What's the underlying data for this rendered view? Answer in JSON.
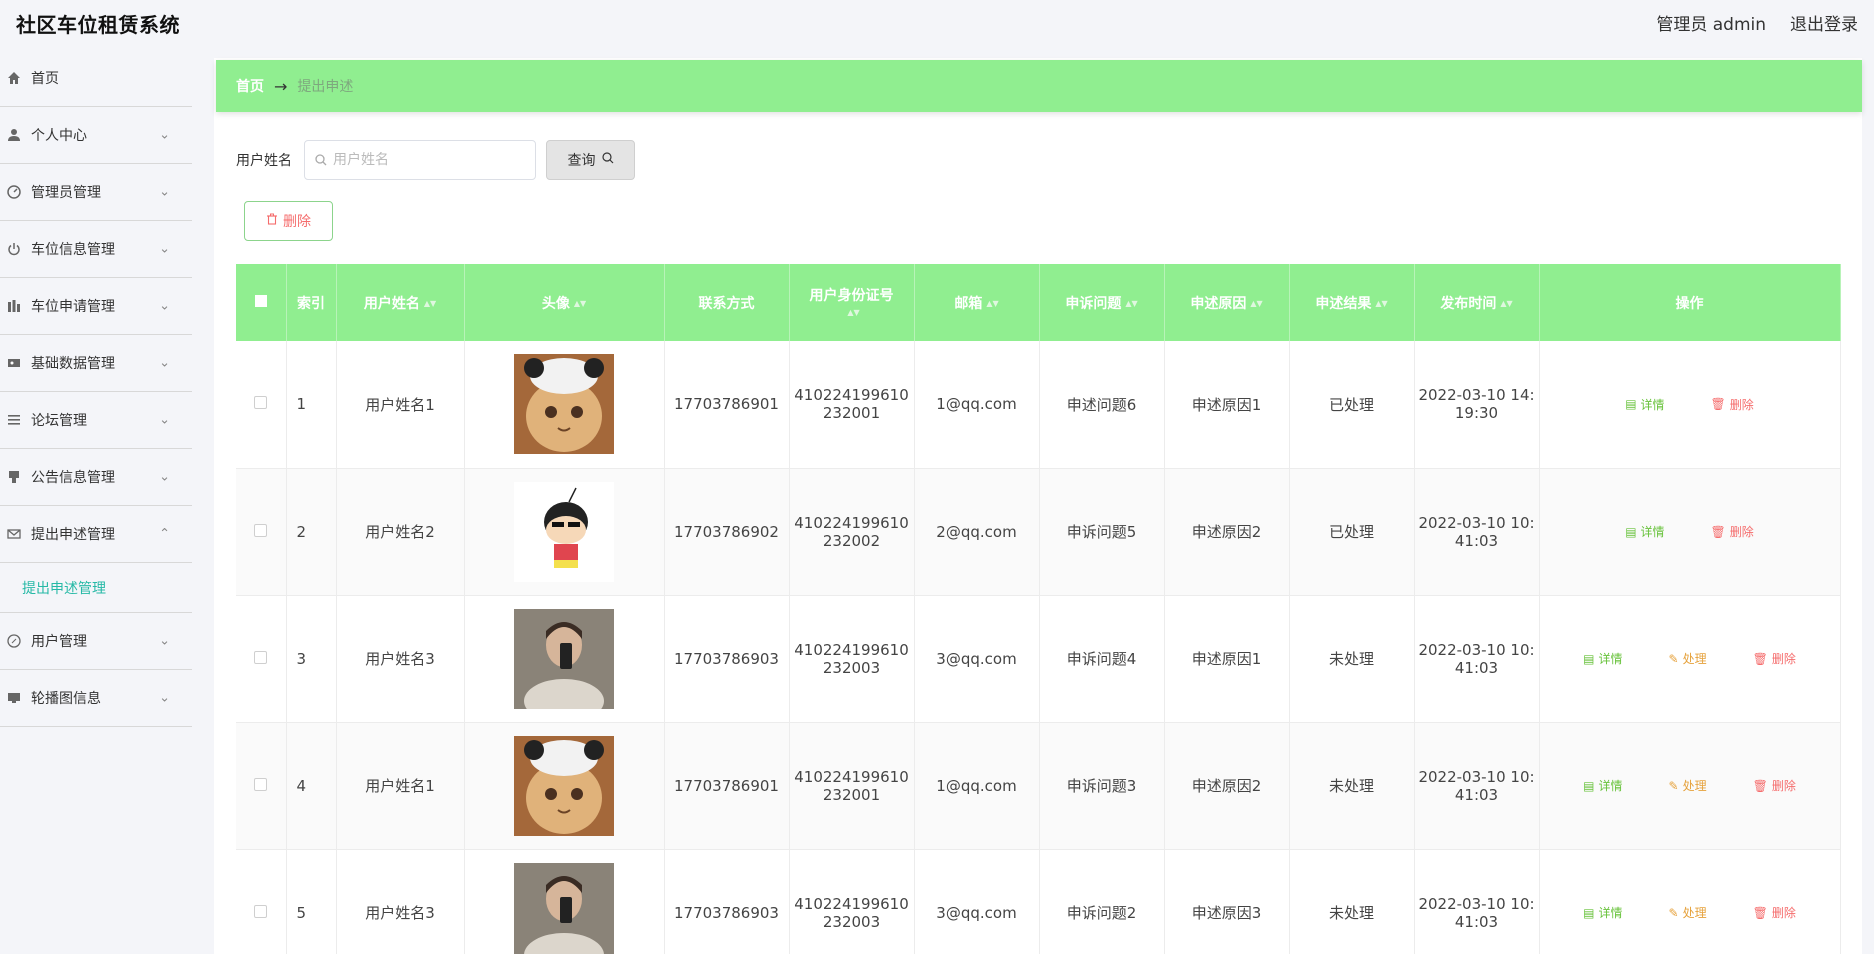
{
  "app": {
    "title": "社区车位租赁系统"
  },
  "header": {
    "user_label": "管理员 admin",
    "logout_label": "退出登录"
  },
  "sidebar": {
    "items": [
      {
        "label": "首页",
        "icon": "home-icon"
      },
      {
        "label": "个人中心",
        "icon": "user-icon"
      },
      {
        "label": "管理员管理",
        "icon": "gauge-icon"
      },
      {
        "label": "车位信息管理",
        "icon": "power-icon"
      },
      {
        "label": "车位申请管理",
        "icon": "bars-icon"
      },
      {
        "label": "基础数据管理",
        "icon": "ticket-icon"
      },
      {
        "label": "论坛管理",
        "icon": "list-icon"
      },
      {
        "label": "公告信息管理",
        "icon": "tag-icon"
      },
      {
        "label": "提出申述管理",
        "icon": "mail-icon"
      },
      {
        "label": "用户管理",
        "icon": "compass-icon"
      },
      {
        "label": "轮播图信息",
        "icon": "monitor-icon"
      }
    ],
    "active_sub": "提出申述管理"
  },
  "breadcrumb": {
    "home": "首页",
    "separator": "→",
    "current": "提出申述"
  },
  "search": {
    "label": "用户姓名",
    "placeholder": "用户姓名",
    "button": "查询"
  },
  "toolbar": {
    "delete_label": "删除"
  },
  "table": {
    "columns": [
      "索引",
      "用户姓名",
      "头像",
      "联系方式",
      "用户身份证号",
      "邮箱",
      "申诉问题",
      "申述原因",
      "申述结果",
      "发布时间",
      "操作"
    ],
    "rows": [
      {
        "index": "1",
        "name": "用户姓名1",
        "avatar": "cat",
        "phone": "17703786901",
        "id1": "410224199610",
        "id2": "232001",
        "email": "1@qq.com",
        "problem": "申述问题6",
        "reason": "申述原因1",
        "result": "已处理",
        "time1": "2022-03-10 14:",
        "time2": "19:30"
      },
      {
        "index": "2",
        "name": "用户姓名2",
        "avatar": "cartoon",
        "phone": "17703786902",
        "id1": "410224199610",
        "id2": "232002",
        "email": "2@qq.com",
        "problem": "申诉问题5",
        "reason": "申述原因2",
        "result": "已处理",
        "time1": "2022-03-10 10:",
        "time2": "41:03"
      },
      {
        "index": "3",
        "name": "用户姓名3",
        "avatar": "person",
        "phone": "17703786903",
        "id1": "410224199610",
        "id2": "232003",
        "email": "3@qq.com",
        "problem": "申诉问题4",
        "reason": "申述原因1",
        "result": "未处理",
        "time1": "2022-03-10 10:",
        "time2": "41:03"
      },
      {
        "index": "4",
        "name": "用户姓名1",
        "avatar": "cat",
        "phone": "17703786901",
        "id1": "410224199610",
        "id2": "232001",
        "email": "1@qq.com",
        "problem": "申诉问题3",
        "reason": "申述原因2",
        "result": "未处理",
        "time1": "2022-03-10 10:",
        "time2": "41:03"
      },
      {
        "index": "5",
        "name": "用户姓名3",
        "avatar": "person",
        "phone": "17703786903",
        "id1": "410224199610",
        "id2": "232003",
        "email": "3@qq.com",
        "problem": "申诉问题2",
        "reason": "申述原因3",
        "result": "未处理",
        "time1": "2022-03-10 10:",
        "time2": "41:03"
      }
    ],
    "actions": {
      "view": "详情",
      "handle": "处理",
      "delete": "删除"
    }
  },
  "colors": {
    "accent": "#90ee90",
    "active_text": "#26b9a6",
    "danger": "#f56c6c",
    "warning": "#e6a23c",
    "success": "#67c23a"
  }
}
